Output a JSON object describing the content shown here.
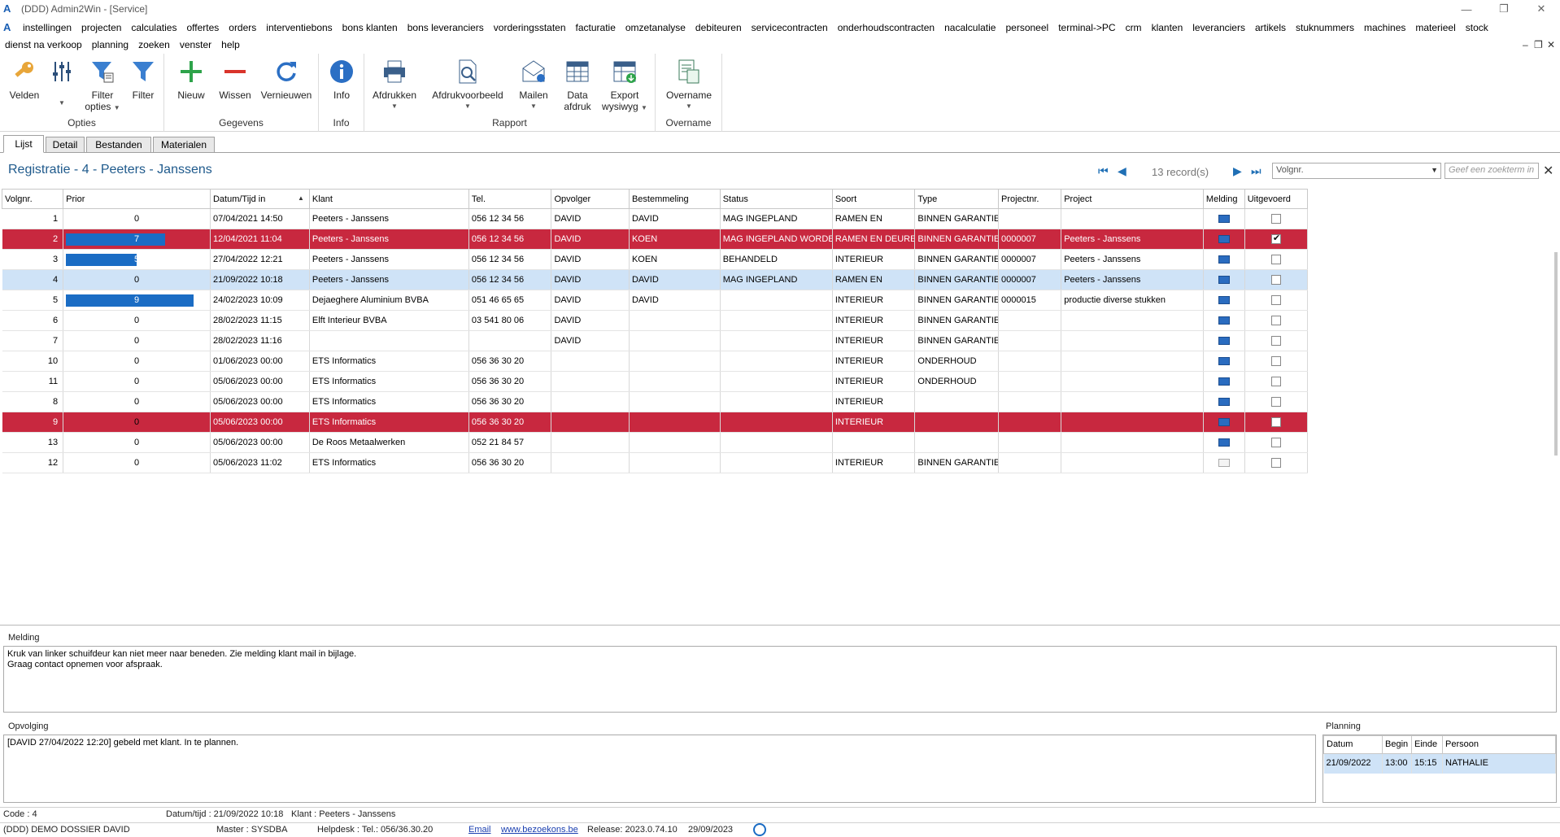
{
  "window": {
    "title": "(DDD) Admin2Win - [Service]",
    "app_icon": "A"
  },
  "menu": {
    "row1": [
      "instellingen",
      "projecten",
      "calculaties",
      "offertes",
      "orders",
      "interventiebons",
      "bons klanten",
      "bons leveranciers",
      "vorderingsstaten",
      "facturatie",
      "omzetanalyse",
      "debiteuren",
      "servicecontracten",
      "onderhoudscontracten",
      "nacalculatie",
      "personeel",
      "terminal->PC",
      "crm",
      "klanten",
      "leveranciers",
      "artikels",
      "stuknummers",
      "machines",
      "materieel",
      "stock"
    ],
    "row2": [
      "dienst na verkoop",
      "planning",
      "zoeken",
      "venster",
      "help"
    ]
  },
  "ribbon": {
    "groups": {
      "opties": "Opties",
      "gegevens": "Gegevens",
      "info": "Info",
      "rapport": "Rapport",
      "overname": "Overname"
    },
    "buttons": {
      "velden": "Velden",
      "filter_opties_1": "Filter",
      "filter_opties_2": "opties",
      "filter": "Filter",
      "nieuw": "Nieuw",
      "wissen": "Wissen",
      "vernieuwen": "Vernieuwen",
      "info": "Info",
      "afdrukken": "Afdrukken",
      "afdrukvoorbeeld": "Afdrukvoorbeeld",
      "mailen": "Mailen",
      "data_afdruk_1": "Data",
      "data_afdruk_2": "afdruk",
      "export_1": "Export",
      "export_2": "wysiwyg",
      "overname": "Overname"
    }
  },
  "tabs": [
    "Lijst",
    "Detail",
    "Bestanden",
    "Materialen"
  ],
  "header": {
    "title": "Registratie - 4 - Peeters - Janssens",
    "record_count": "13 record(s)",
    "sort_field": "Volgnr.",
    "search_placeholder": "Geef een zoekterm in"
  },
  "grid": {
    "columns": [
      "Volgnr.",
      "Prior",
      "Datum/Tijd in",
      "Klant",
      "Tel.",
      "Opvolger",
      "Bestemmeling",
      "Status",
      "Soort",
      "Type",
      "Projectnr.",
      "Project",
      "Melding",
      "Uitgevoerd"
    ],
    "rows": [
      {
        "volgnr": "1",
        "prior": "0",
        "prior_fill": 0,
        "datum": "07/04/2021 14:50",
        "klant": "Peeters - Janssens",
        "tel": "056 12 34 56",
        "opvolger": "DAVID",
        "bestemmeling": "DAVID",
        "status": "MAG INGEPLAND",
        "soort": "RAMEN EN",
        "type": "BINNEN GARANTIE",
        "projectnr": "",
        "project": "",
        "melding": true,
        "uitgevoerd": false,
        "state": ""
      },
      {
        "volgnr": "2",
        "prior": "7",
        "prior_fill": 0.7,
        "datum": "12/04/2021 11:04",
        "klant": "Peeters - Janssens",
        "tel": "056 12 34 56",
        "opvolger": "DAVID",
        "bestemmeling": "KOEN",
        "status": "MAG INGEPLAND WORDEN",
        "soort": "RAMEN EN DEUREN",
        "type": "BINNEN GARANTIE",
        "projectnr": "0000007",
        "project": "Peeters - Janssens",
        "melding": true,
        "uitgevoerd": true,
        "state": "red"
      },
      {
        "volgnr": "3",
        "prior": "5",
        "prior_fill": 0.5,
        "datum": "27/04/2022 12:21",
        "klant": "Peeters - Janssens",
        "tel": "056 12 34 56",
        "opvolger": "DAVID",
        "bestemmeling": "KOEN",
        "status": "BEHANDELD",
        "soort": "INTERIEUR",
        "type": "BINNEN GARANTIE",
        "projectnr": "0000007",
        "project": "Peeters - Janssens",
        "melding": true,
        "uitgevoerd": false,
        "state": ""
      },
      {
        "volgnr": "4",
        "prior": "0",
        "prior_fill": 0,
        "datum": "21/09/2022 10:18",
        "klant": "Peeters - Janssens",
        "tel": "056 12 34 56",
        "opvolger": "DAVID",
        "bestemmeling": "DAVID",
        "status": "MAG INGEPLAND",
        "soort": "RAMEN EN",
        "type": "BINNEN GARANTIE",
        "projectnr": "0000007",
        "project": "Peeters - Janssens",
        "melding": true,
        "uitgevoerd": false,
        "state": "blue"
      },
      {
        "volgnr": "5",
        "prior": "9",
        "prior_fill": 0.9,
        "datum": "24/02/2023 10:09",
        "klant": "Dejaeghere Aluminium BVBA",
        "tel": "051 46 65 65",
        "opvolger": "DAVID",
        "bestemmeling": "DAVID",
        "status": "",
        "soort": "INTERIEUR",
        "type": "BINNEN GARANTIE",
        "projectnr": "0000015",
        "project": "productie diverse stukken",
        "melding": true,
        "uitgevoerd": false,
        "state": ""
      },
      {
        "volgnr": "6",
        "prior": "0",
        "prior_fill": 0,
        "datum": "28/02/2023 11:15",
        "klant": "Elft Interieur BVBA",
        "tel": "03 541 80 06",
        "opvolger": "DAVID",
        "bestemmeling": "",
        "status": "",
        "soort": "INTERIEUR",
        "type": "BINNEN GARANTIE",
        "projectnr": "",
        "project": "",
        "melding": true,
        "uitgevoerd": false,
        "state": ""
      },
      {
        "volgnr": "7",
        "prior": "0",
        "prior_fill": 0,
        "datum": "28/02/2023 11:16",
        "klant": "",
        "tel": "",
        "opvolger": "DAVID",
        "bestemmeling": "",
        "status": "",
        "soort": "INTERIEUR",
        "type": "BINNEN GARANTIE",
        "projectnr": "",
        "project": "",
        "melding": true,
        "uitgevoerd": false,
        "state": ""
      },
      {
        "volgnr": "10",
        "prior": "0",
        "prior_fill": 0,
        "datum": "01/06/2023 00:00",
        "klant": "ETS Informatics",
        "tel": "056 36 30 20",
        "opvolger": "",
        "bestemmeling": "",
        "status": "",
        "soort": "INTERIEUR",
        "type": "ONDERHOUD",
        "projectnr": "",
        "project": "",
        "melding": true,
        "uitgevoerd": false,
        "state": ""
      },
      {
        "volgnr": "11",
        "prior": "0",
        "prior_fill": 0,
        "datum": "05/06/2023 00:00",
        "klant": "ETS Informatics",
        "tel": "056 36 30 20",
        "opvolger": "",
        "bestemmeling": "",
        "status": "",
        "soort": "INTERIEUR",
        "type": "ONDERHOUD",
        "projectnr": "",
        "project": "",
        "melding": true,
        "uitgevoerd": false,
        "state": ""
      },
      {
        "volgnr": "8",
        "prior": "0",
        "prior_fill": 0,
        "datum": "05/06/2023 00:00",
        "klant": "ETS Informatics",
        "tel": "056 36 30 20",
        "opvolger": "",
        "bestemmeling": "",
        "status": "",
        "soort": "INTERIEUR",
        "type": "",
        "projectnr": "",
        "project": "",
        "melding": true,
        "uitgevoerd": false,
        "state": ""
      },
      {
        "volgnr": "9",
        "prior": "0",
        "prior_fill": 0,
        "datum": "05/06/2023 00:00",
        "klant": "ETS Informatics",
        "tel": "056 36 30 20",
        "opvolger": "",
        "bestemmeling": "",
        "status": "",
        "soort": "INTERIEUR",
        "type": "",
        "projectnr": "",
        "project": "",
        "melding": true,
        "uitgevoerd": false,
        "state": "red"
      },
      {
        "volgnr": "13",
        "prior": "0",
        "prior_fill": 0,
        "datum": "05/06/2023 00:00",
        "klant": "De Roos Metaalwerken",
        "tel": "052 21 84 57",
        "opvolger": "",
        "bestemmeling": "",
        "status": "",
        "soort": "",
        "type": "",
        "projectnr": "",
        "project": "",
        "melding": true,
        "uitgevoerd": false,
        "state": ""
      },
      {
        "volgnr": "12",
        "prior": "0",
        "prior_fill": 0,
        "datum": "05/06/2023 11:02",
        "klant": "ETS Informatics",
        "tel": "056 36 30 20",
        "opvolger": "",
        "bestemmeling": "",
        "status": "",
        "soort": "INTERIEUR",
        "type": "BINNEN GARANTIE",
        "projectnr": "",
        "project": "",
        "melding": false,
        "uitgevoerd": false,
        "state": ""
      }
    ]
  },
  "melding": {
    "label": "Melding",
    "line1": "Kruk van linker schuifdeur kan niet meer naar beneden.  Zie melding klant mail in bijlage.",
    "line2": "Graag contact opnemen voor afspraak."
  },
  "opvolging": {
    "label": "Opvolging",
    "text": "[DAVID 27/04/2022 12:20] gebeld met klant.  In te plannen."
  },
  "planning": {
    "label": "Planning",
    "columns": [
      "Datum",
      "Begin",
      "Einde",
      "Persoon"
    ],
    "rows": [
      [
        "21/09/2022",
        "13:00",
        "15:15",
        "NATHALIE"
      ]
    ]
  },
  "status1": {
    "code": "Code : 4",
    "datum": "Datum/tijd : 21/09/2022 10:18",
    "klant": "Klant : Peeters - Janssens"
  },
  "status2": {
    "dossier": "(DDD) DEMO DOSSIER DAVID",
    "master": "Master : SYSDBA",
    "helpdesk": "Helpdesk : Tel.: 056/36.30.20",
    "email": "Email",
    "website": "www.bezoekons.be",
    "release": "Release: 2023.0.74.10",
    "date": "29/09/2023"
  },
  "colors": {
    "accent": "#1f5a8c",
    "row_red": "#c8283f",
    "row_blue": "#cfe3f7",
    "prior_bar": "#1a6cc4"
  }
}
